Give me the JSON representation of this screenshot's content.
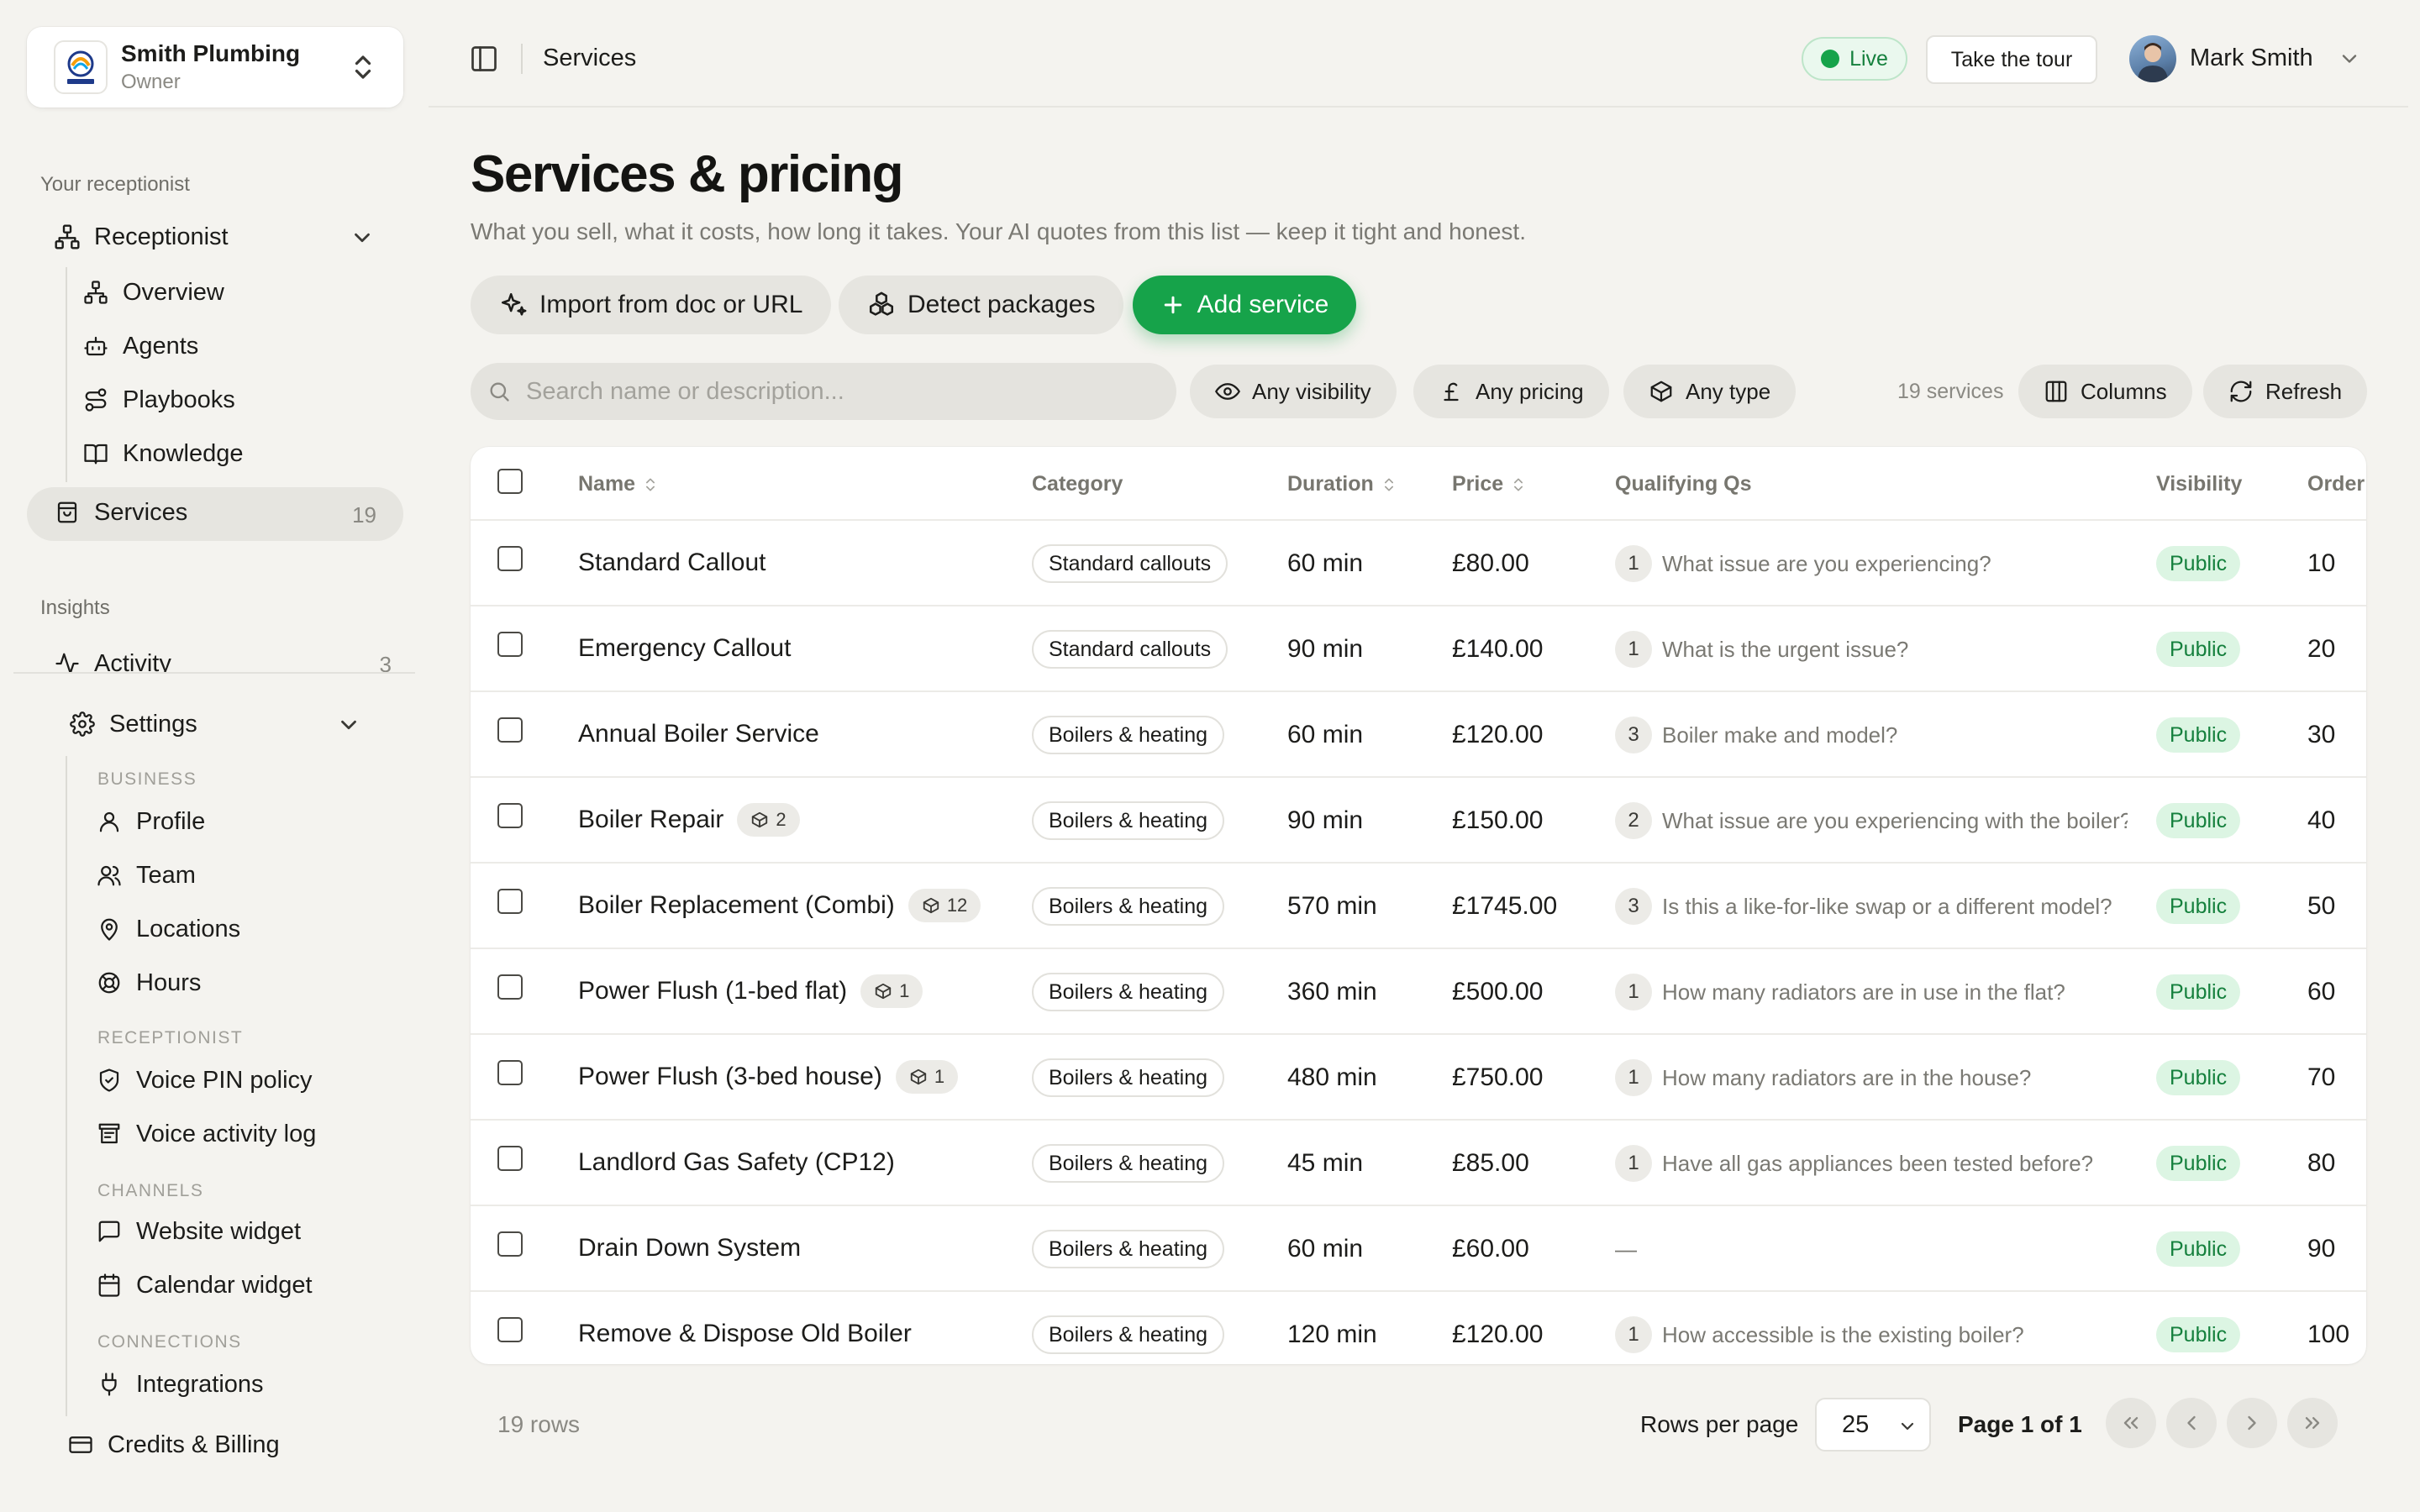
{
  "business": {
    "name": "Smith Plumbing",
    "role": "Owner",
    "logo_text": "COMPANY"
  },
  "sidebar": {
    "section_receptionist": "Your receptionist",
    "receptionist": "Receptionist",
    "items": [
      {
        "label": "Overview"
      },
      {
        "label": "Agents"
      },
      {
        "label": "Playbooks"
      },
      {
        "label": "Knowledge"
      }
    ],
    "services": {
      "label": "Services",
      "count": "19"
    },
    "section_insights": "Insights",
    "activity": {
      "label": "Activity",
      "count": "3"
    },
    "settings": "Settings",
    "group_business": "BUSINESS",
    "business_items": [
      {
        "label": "Profile"
      },
      {
        "label": "Team"
      },
      {
        "label": "Locations"
      },
      {
        "label": "Hours"
      }
    ],
    "group_receptionist": "RECEPTIONIST",
    "receptionist_items": [
      {
        "label": "Voice PIN policy"
      },
      {
        "label": "Voice activity log"
      }
    ],
    "group_channels": "CHANNELS",
    "channel_items": [
      {
        "label": "Website widget"
      },
      {
        "label": "Calendar widget"
      }
    ],
    "group_connections": "CONNECTIONS",
    "connection_items": [
      {
        "label": "Integrations"
      }
    ],
    "credits": "Credits & Billing"
  },
  "topbar": {
    "breadcrumb": "Services",
    "live": "Live",
    "tour": "Take the tour",
    "user": "Mark Smith"
  },
  "page": {
    "title": "Services & pricing",
    "subtitle": "What you sell, what it costs, how long it takes. Your AI quotes from this list — keep it tight and honest."
  },
  "actions": {
    "import": "Import from doc or URL",
    "detect": "Detect packages",
    "add": "Add service"
  },
  "toolbar": {
    "search_placeholder": "Search name or description...",
    "visibility": "Any visibility",
    "pricing": "Any pricing",
    "type": "Any type",
    "count": "19 services",
    "columns": "Columns",
    "refresh": "Refresh"
  },
  "table": {
    "headers": {
      "name": "Name",
      "category": "Category",
      "duration": "Duration",
      "price": "Price",
      "qualifying": "Qualifying Qs",
      "visibility": "Visibility",
      "order": "Order"
    },
    "rows": [
      {
        "name": "Standard Callout",
        "badge": "",
        "category": "Standard callouts",
        "duration": "60 min",
        "price": "£80.00",
        "qcount": "1",
        "question": "What issue are you experiencing?",
        "visibility": "Public",
        "order": "10"
      },
      {
        "name": "Emergency Callout",
        "badge": "",
        "category": "Standard callouts",
        "duration": "90 min",
        "price": "£140.00",
        "qcount": "1",
        "question": "What is the urgent issue?",
        "visibility": "Public",
        "order": "20"
      },
      {
        "name": "Annual Boiler Service",
        "badge": "",
        "category": "Boilers & heating",
        "duration": "60 min",
        "price": "£120.00",
        "qcount": "3",
        "question": "Boiler make and model?",
        "visibility": "Public",
        "order": "30"
      },
      {
        "name": "Boiler Repair",
        "badge": "2",
        "category": "Boilers & heating",
        "duration": "90 min",
        "price": "£150.00",
        "qcount": "2",
        "question": "What issue are you experiencing with the boiler?",
        "visibility": "Public",
        "order": "40"
      },
      {
        "name": "Boiler Replacement (Combi)",
        "badge": "12",
        "category": "Boilers & heating",
        "duration": "570 min",
        "price": "£1745.00",
        "qcount": "3",
        "question": "Is this a like-for-like swap or a different model?",
        "visibility": "Public",
        "order": "50"
      },
      {
        "name": "Power Flush (1-bed flat)",
        "badge": "1",
        "category": "Boilers & heating",
        "duration": "360 min",
        "price": "£500.00",
        "qcount": "1",
        "question": "How many radiators are in use in the flat?",
        "visibility": "Public",
        "order": "60"
      },
      {
        "name": "Power Flush (3-bed house)",
        "badge": "1",
        "category": "Boilers & heating",
        "duration": "480 min",
        "price": "£750.00",
        "qcount": "1",
        "question": "How many radiators are in the house?",
        "visibility": "Public",
        "order": "70"
      },
      {
        "name": "Landlord Gas Safety (CP12)",
        "badge": "",
        "category": "Boilers & heating",
        "duration": "45 min",
        "price": "£85.00",
        "qcount": "1",
        "question": "Have all gas appliances been tested before?",
        "visibility": "Public",
        "order": "80"
      },
      {
        "name": "Drain Down System",
        "badge": "",
        "category": "Boilers & heating",
        "duration": "60 min",
        "price": "£60.00",
        "qcount": "",
        "question": "—",
        "visibility": "Public",
        "order": "90"
      },
      {
        "name": "Remove & Dispose Old Boiler",
        "badge": "",
        "category": "Boilers & heating",
        "duration": "120 min",
        "price": "£120.00",
        "qcount": "1",
        "question": "How accessible is the existing boiler?",
        "visibility": "Public",
        "order": "100"
      }
    ]
  },
  "footer": {
    "rows": "19 rows",
    "rows_per_page_label": "Rows per page",
    "rows_per_page": "25",
    "page": "Page 1 of 1"
  },
  "colors": {
    "accent": "#16a34a",
    "background": "#f4f3ef",
    "surface": "#ffffff",
    "public_badge": "#dcf5e3"
  }
}
